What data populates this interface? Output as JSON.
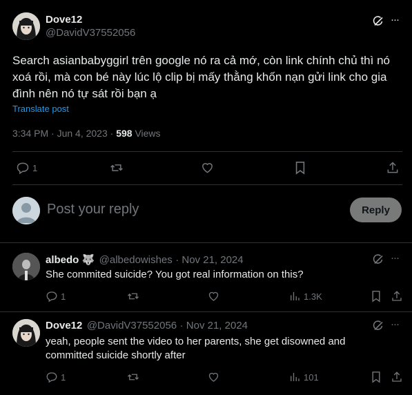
{
  "main_post": {
    "author_name": "Dove12",
    "author_handle": "@DavidV37552056",
    "text_line1": "Search asianbabyggirl trên google nó ra cả mớ, còn link chính chủ thì nó",
    "text_line2": "xoá rồi, mà con bé này lúc lộ clip bị mấy thằng khốn nạn gửi link cho gia",
    "text_line3": "đình nên nó tự sát rồi bạn ạ",
    "translate_label": "Translate post",
    "timestamp": "3:34 PM · Jun 4, 2023 ·",
    "views_count": "598",
    "views_label": "Views",
    "reply_count": "1",
    "more_label": "···"
  },
  "reply_composer": {
    "placeholder": "Post your reply",
    "button_label": "Reply"
  },
  "replies": [
    {
      "author_name": "albedo 🐺",
      "author_handle": "@albedowishes",
      "date": "· Nov 21, 2024",
      "text": "She commited suicide? You got real information on this?",
      "reply_count": "1",
      "views": "1.3K",
      "more_label": "···"
    },
    {
      "author_name": "Dove12",
      "author_handle": "@DavidV37552056",
      "date": "· Nov 21, 2024",
      "text_line1": "yeah, people sent the video to her parents, she get disowned and",
      "text_line2": "committed suicide shortly after",
      "reply_count": "1",
      "views": "101",
      "more_label": "···"
    }
  ],
  "colors": {
    "background": "#000000",
    "text": "#e7e9ea",
    "muted": "#71767b",
    "link": "#1d9bf0",
    "divider": "#2f3336",
    "reply_button": "#787a7a"
  }
}
